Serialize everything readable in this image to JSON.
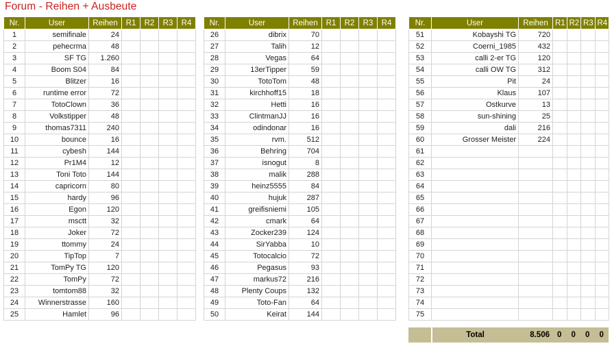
{
  "title": "Forum - Reihen + Ausbeute",
  "colors": {
    "title": "#cc2020",
    "header_bg": "#7f8000",
    "header_text": "#ffffff",
    "total_bg": "#c5bd94",
    "grid_line": "#d4d4d4"
  },
  "columns": {
    "nr": "Nr.",
    "user": "User",
    "reihen": "Reihen",
    "r1": "R1",
    "r2": "R2",
    "r3": "R3",
    "r4": "R4"
  },
  "tables": [
    {
      "id": "table-1",
      "rows": [
        {
          "nr": "1",
          "user": "semifinale",
          "reihen": "24",
          "r1": "",
          "r2": "",
          "r3": "",
          "r4": ""
        },
        {
          "nr": "2",
          "user": "pehecrma",
          "reihen": "48",
          "r1": "",
          "r2": "",
          "r3": "",
          "r4": ""
        },
        {
          "nr": "3",
          "user": "SF TG",
          "reihen": "1.260",
          "r1": "",
          "r2": "",
          "r3": "",
          "r4": ""
        },
        {
          "nr": "4",
          "user": "Boom S04",
          "reihen": "84",
          "r1": "",
          "r2": "",
          "r3": "",
          "r4": ""
        },
        {
          "nr": "5",
          "user": "Blitzer",
          "reihen": "16",
          "r1": "",
          "r2": "",
          "r3": "",
          "r4": ""
        },
        {
          "nr": "6",
          "user": "runtime error",
          "reihen": "72",
          "r1": "",
          "r2": "",
          "r3": "",
          "r4": ""
        },
        {
          "nr": "7",
          "user": "TotoClown",
          "reihen": "36",
          "r1": "",
          "r2": "",
          "r3": "",
          "r4": ""
        },
        {
          "nr": "8",
          "user": "Volkstipper",
          "reihen": "48",
          "r1": "",
          "r2": "",
          "r3": "",
          "r4": ""
        },
        {
          "nr": "9",
          "user": "thomas7311",
          "reihen": "240",
          "r1": "",
          "r2": "",
          "r3": "",
          "r4": ""
        },
        {
          "nr": "10",
          "user": "bounce",
          "reihen": "16",
          "r1": "",
          "r2": "",
          "r3": "",
          "r4": ""
        },
        {
          "nr": "11",
          "user": "cybesh",
          "reihen": "144",
          "r1": "",
          "r2": "",
          "r3": "",
          "r4": ""
        },
        {
          "nr": "12",
          "user": "Pr1M4",
          "reihen": "12",
          "r1": "",
          "r2": "",
          "r3": "",
          "r4": ""
        },
        {
          "nr": "13",
          "user": "Toni Toto",
          "reihen": "144",
          "r1": "",
          "r2": "",
          "r3": "",
          "r4": ""
        },
        {
          "nr": "14",
          "user": "capricorn",
          "reihen": "80",
          "r1": "",
          "r2": "",
          "r3": "",
          "r4": ""
        },
        {
          "nr": "15",
          "user": "hardy",
          "reihen": "96",
          "r1": "",
          "r2": "",
          "r3": "",
          "r4": ""
        },
        {
          "nr": "16",
          "user": "Egon",
          "reihen": "120",
          "r1": "",
          "r2": "",
          "r3": "",
          "r4": ""
        },
        {
          "nr": "17",
          "user": "msctt",
          "reihen": "32",
          "r1": "",
          "r2": "",
          "r3": "",
          "r4": ""
        },
        {
          "nr": "18",
          "user": "Joker",
          "reihen": "72",
          "r1": "",
          "r2": "",
          "r3": "",
          "r4": ""
        },
        {
          "nr": "19",
          "user": "ttommy",
          "reihen": "24",
          "r1": "",
          "r2": "",
          "r3": "",
          "r4": ""
        },
        {
          "nr": "20",
          "user": "TipTop",
          "reihen": "7",
          "r1": "",
          "r2": "",
          "r3": "",
          "r4": ""
        },
        {
          "nr": "21",
          "user": "TomPy TG",
          "reihen": "120",
          "r1": "",
          "r2": "",
          "r3": "",
          "r4": ""
        },
        {
          "nr": "22",
          "user": "TomPy",
          "reihen": "72",
          "r1": "",
          "r2": "",
          "r3": "",
          "r4": ""
        },
        {
          "nr": "23",
          "user": "tomtom88",
          "reihen": "32",
          "r1": "",
          "r2": "",
          "r3": "",
          "r4": ""
        },
        {
          "nr": "24",
          "user": "Winnerstrasse",
          "reihen": "160",
          "r1": "",
          "r2": "",
          "r3": "",
          "r4": ""
        },
        {
          "nr": "25",
          "user": "Hamlet",
          "reihen": "96",
          "r1": "",
          "r2": "",
          "r3": "",
          "r4": ""
        }
      ]
    },
    {
      "id": "table-2",
      "rows": [
        {
          "nr": "26",
          "user": "dibrix",
          "reihen": "70",
          "r1": "",
          "r2": "",
          "r3": "",
          "r4": ""
        },
        {
          "nr": "27",
          "user": "Talih",
          "reihen": "12",
          "r1": "",
          "r2": "",
          "r3": "",
          "r4": ""
        },
        {
          "nr": "28",
          "user": "Vegas",
          "reihen": "64",
          "r1": "",
          "r2": "",
          "r3": "",
          "r4": ""
        },
        {
          "nr": "29",
          "user": "13erTipper",
          "reihen": "59",
          "r1": "",
          "r2": "",
          "r3": "",
          "r4": ""
        },
        {
          "nr": "30",
          "user": "TotoTom",
          "reihen": "48",
          "r1": "",
          "r2": "",
          "r3": "",
          "r4": ""
        },
        {
          "nr": "31",
          "user": "kirchhoff15",
          "reihen": "18",
          "r1": "",
          "r2": "",
          "r3": "",
          "r4": ""
        },
        {
          "nr": "32",
          "user": "Hetti",
          "reihen": "16",
          "r1": "",
          "r2": "",
          "r3": "",
          "r4": ""
        },
        {
          "nr": "33",
          "user": "ClintmanJJ",
          "reihen": "16",
          "r1": "",
          "r2": "",
          "r3": "",
          "r4": ""
        },
        {
          "nr": "34",
          "user": "odindonar",
          "reihen": "16",
          "r1": "",
          "r2": "",
          "r3": "",
          "r4": ""
        },
        {
          "nr": "35",
          "user": "rvm.",
          "reihen": "512",
          "r1": "",
          "r2": "",
          "r3": "",
          "r4": ""
        },
        {
          "nr": "36",
          "user": "Behring",
          "reihen": "704",
          "r1": "",
          "r2": "",
          "r3": "",
          "r4": ""
        },
        {
          "nr": "37",
          "user": "isnogut",
          "reihen": "8",
          "r1": "",
          "r2": "",
          "r3": "",
          "r4": ""
        },
        {
          "nr": "38",
          "user": "malik",
          "reihen": "288",
          "r1": "",
          "r2": "",
          "r3": "",
          "r4": ""
        },
        {
          "nr": "39",
          "user": "heinz5555",
          "reihen": "84",
          "r1": "",
          "r2": "",
          "r3": "",
          "r4": ""
        },
        {
          "nr": "40",
          "user": "hujuk",
          "reihen": "287",
          "r1": "",
          "r2": "",
          "r3": "",
          "r4": ""
        },
        {
          "nr": "41",
          "user": "greifisniemi",
          "reihen": "105",
          "r1": "",
          "r2": "",
          "r3": "",
          "r4": ""
        },
        {
          "nr": "42",
          "user": "cmark",
          "reihen": "64",
          "r1": "",
          "r2": "",
          "r3": "",
          "r4": ""
        },
        {
          "nr": "43",
          "user": "Zocker239",
          "reihen": "124",
          "r1": "",
          "r2": "",
          "r3": "",
          "r4": ""
        },
        {
          "nr": "44",
          "user": "SirYabba",
          "reihen": "10",
          "r1": "",
          "r2": "",
          "r3": "",
          "r4": ""
        },
        {
          "nr": "45",
          "user": "Totocalcio",
          "reihen": "72",
          "r1": "",
          "r2": "",
          "r3": "",
          "r4": ""
        },
        {
          "nr": "46",
          "user": "Pegasus",
          "reihen": "93",
          "r1": "",
          "r2": "",
          "r3": "",
          "r4": ""
        },
        {
          "nr": "47",
          "user": "markus72",
          "reihen": "216",
          "r1": "",
          "r2": "",
          "r3": "",
          "r4": ""
        },
        {
          "nr": "48",
          "user": "Plenty Coups",
          "reihen": "132",
          "r1": "",
          "r2": "",
          "r3": "",
          "r4": ""
        },
        {
          "nr": "49",
          "user": "Toto-Fan",
          "reihen": "64",
          "r1": "",
          "r2": "",
          "r3": "",
          "r4": ""
        },
        {
          "nr": "50",
          "user": "Keirat",
          "reihen": "144",
          "r1": "",
          "r2": "",
          "r3": "",
          "r4": ""
        }
      ]
    },
    {
      "id": "table-3",
      "rows": [
        {
          "nr": "51",
          "user": "Kobayshi TG",
          "reihen": "720",
          "r1": "",
          "r2": "",
          "r3": "",
          "r4": ""
        },
        {
          "nr": "52",
          "user": "Coerni_1985",
          "reihen": "432",
          "r1": "",
          "r2": "",
          "r3": "",
          "r4": ""
        },
        {
          "nr": "53",
          "user": "calli 2-er TG",
          "reihen": "120",
          "r1": "",
          "r2": "",
          "r3": "",
          "r4": ""
        },
        {
          "nr": "54",
          "user": "calli OW TG",
          "reihen": "312",
          "r1": "",
          "r2": "",
          "r3": "",
          "r4": ""
        },
        {
          "nr": "55",
          "user": "Pit",
          "reihen": "24",
          "r1": "",
          "r2": "",
          "r3": "",
          "r4": ""
        },
        {
          "nr": "56",
          "user": "Klaus",
          "reihen": "107",
          "r1": "",
          "r2": "",
          "r3": "",
          "r4": ""
        },
        {
          "nr": "57",
          "user": "Ostkurve",
          "reihen": "13",
          "r1": "",
          "r2": "",
          "r3": "",
          "r4": ""
        },
        {
          "nr": "58",
          "user": "sun-shining",
          "reihen": "25",
          "r1": "",
          "r2": "",
          "r3": "",
          "r4": ""
        },
        {
          "nr": "59",
          "user": "dali",
          "reihen": "216",
          "r1": "",
          "r2": "",
          "r3": "",
          "r4": ""
        },
        {
          "nr": "60",
          "user": "Grosser Meister",
          "reihen": "224",
          "r1": "",
          "r2": "",
          "r3": "",
          "r4": ""
        },
        {
          "nr": "61",
          "user": "",
          "reihen": "",
          "r1": "",
          "r2": "",
          "r3": "",
          "r4": ""
        },
        {
          "nr": "62",
          "user": "",
          "reihen": "",
          "r1": "",
          "r2": "",
          "r3": "",
          "r4": ""
        },
        {
          "nr": "63",
          "user": "",
          "reihen": "",
          "r1": "",
          "r2": "",
          "r3": "",
          "r4": ""
        },
        {
          "nr": "64",
          "user": "",
          "reihen": "",
          "r1": "",
          "r2": "",
          "r3": "",
          "r4": ""
        },
        {
          "nr": "65",
          "user": "",
          "reihen": "",
          "r1": "",
          "r2": "",
          "r3": "",
          "r4": ""
        },
        {
          "nr": "66",
          "user": "",
          "reihen": "",
          "r1": "",
          "r2": "",
          "r3": "",
          "r4": ""
        },
        {
          "nr": "67",
          "user": "",
          "reihen": "",
          "r1": "",
          "r2": "",
          "r3": "",
          "r4": ""
        },
        {
          "nr": "68",
          "user": "",
          "reihen": "",
          "r1": "",
          "r2": "",
          "r3": "",
          "r4": ""
        },
        {
          "nr": "69",
          "user": "",
          "reihen": "",
          "r1": "",
          "r2": "",
          "r3": "",
          "r4": ""
        },
        {
          "nr": "70",
          "user": "",
          "reihen": "",
          "r1": "",
          "r2": "",
          "r3": "",
          "r4": ""
        },
        {
          "nr": "71",
          "user": "",
          "reihen": "",
          "r1": "",
          "r2": "",
          "r3": "",
          "r4": ""
        },
        {
          "nr": "72",
          "user": "",
          "reihen": "",
          "r1": "",
          "r2": "",
          "r3": "",
          "r4": ""
        },
        {
          "nr": "73",
          "user": "",
          "reihen": "",
          "r1": "",
          "r2": "",
          "r3": "",
          "r4": ""
        },
        {
          "nr": "74",
          "user": "",
          "reihen": "",
          "r1": "",
          "r2": "",
          "r3": "",
          "r4": ""
        },
        {
          "nr": "75",
          "user": "",
          "reihen": "",
          "r1": "",
          "r2": "",
          "r3": "",
          "r4": ""
        }
      ]
    }
  ],
  "total": {
    "nr": "",
    "label": "Total",
    "reihen": "8.506",
    "r1": "0",
    "r2": "0",
    "r3": "0",
    "r4": "0"
  }
}
